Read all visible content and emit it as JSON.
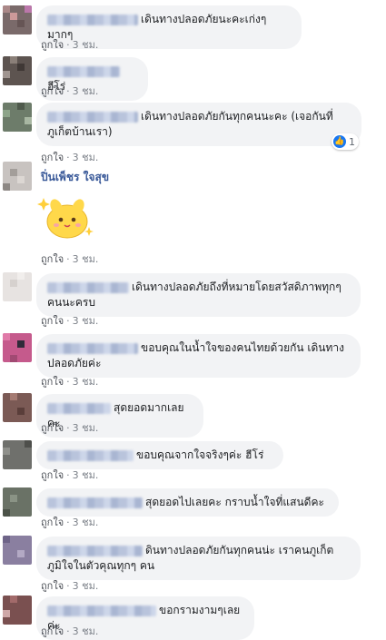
{
  "like_label": "ถูกใจ",
  "separator": "·",
  "comments": [
    {
      "text": "เดินทางปลอดภัยนะคะเก่งๆมากๆ",
      "time": "3 ชม."
    },
    {
      "text": "ฮีโร่",
      "time": "3 ชม."
    },
    {
      "text": "เดินทางปลอดภัยกันทุกคนนะคะ (เจอกันที่ภูเก็ตบ้านเรา)",
      "time": "3 ชม.",
      "reaction_count": "1"
    },
    {
      "name": "ปิ่นเพ็ชร ใจสุข",
      "time": "3 ชม.",
      "sticker": "yellow-chick-sticker"
    },
    {
      "text": "เดินทางปลอดภัยถึงที่หมายโดยสวัสดิภาพทุกๆคนนะครบ",
      "time": "3 ชม."
    },
    {
      "text": "ขอบคุณในน้ำใจของคนไทยด้วยกัน เดินทางปลอดภัยค่ะ",
      "time": "3 ชม."
    },
    {
      "text": "สุดยอดมากเลยคะ",
      "time": "3 ชม."
    },
    {
      "text": "ขอบคุณจากใจจริงๆค่ะ ฮีโร่",
      "time": "3 ชม."
    },
    {
      "text": "สุดยอดไปเลยคะ กราบน้ำใจที่แสนดีคะ",
      "time": "3 ชม."
    },
    {
      "text": "ดินทางปลอดภัยกันทุกคนน่ะ เราคนภูเก็ตภูมิใจในตัวคุณทุกๆ คน",
      "time": "3 ชม."
    },
    {
      "text": "ขอกรามงามๆเลยค่ะ",
      "time": "3 ชม."
    }
  ],
  "colors": {
    "name_link": "#385898",
    "bubble": "#f2f3f5",
    "like_badge": "#1877f2",
    "meta": "#7a7f87"
  }
}
